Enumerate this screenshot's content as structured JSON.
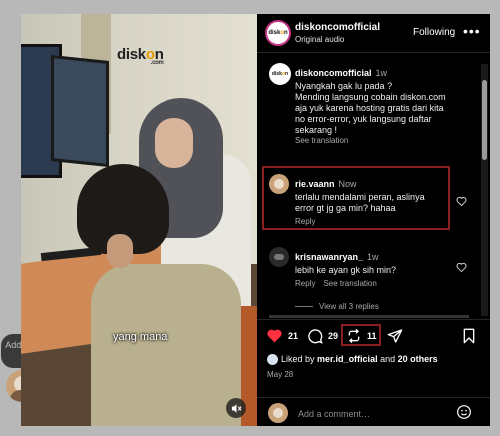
{
  "post": {
    "author": "diskoncomofficial",
    "audio": "Original audio",
    "follow_label": "Following",
    "brand_logo_text": "disk",
    "brand_logo_suffix": "n",
    "brand_logo_domain": ".com",
    "video_caption": "yang mana",
    "caption": {
      "author": "diskoncomofficial",
      "time": "1w",
      "text_lines": [
        "Nyangkah gak lu pada ?",
        "Mending langsung cobain diskon.com",
        "aja yuk karena hosting gratis dari kita",
        "no error-error, yuk langsung daftar",
        "sekarang !"
      ],
      "see_translation": "See translation"
    },
    "comments": [
      {
        "author": "rie.vaann",
        "time": "Now",
        "text_lines": [
          "terlalu mendalami peran, aslinya",
          "error gt jg ga min? hahaa"
        ],
        "reply_label": "Reply"
      },
      {
        "author": "krisnawanryan_",
        "time": "1w",
        "text_lines": [
          "lebih ke ayan gk sih min?"
        ],
        "reply_label": "Reply",
        "see_translation": "See translation",
        "view_replies": "View all 3 replies"
      }
    ],
    "likes_count": "21",
    "comments_count": "29",
    "reposts_count": "11",
    "liked_by_prefix": "Liked by",
    "liked_by_user": "mer.id_official",
    "liked_by_and": "and",
    "liked_by_others": "20 others",
    "date": "May 28",
    "add_comment_placeholder": "Add a comment…"
  },
  "sidebar": {
    "thought_prompt": "Add a thought..."
  },
  "icons": {
    "heart": "heart-icon",
    "comment": "comment-icon",
    "repost": "repost-icon",
    "share": "share-icon",
    "save": "bookmark-icon",
    "emoji": "emoji-icon",
    "mute": "mute-icon",
    "more": "more-icon"
  },
  "colors": {
    "like_active": "#ff3040",
    "highlight_box": "#8b1f1f",
    "story_plus": "#6a4cd8"
  }
}
